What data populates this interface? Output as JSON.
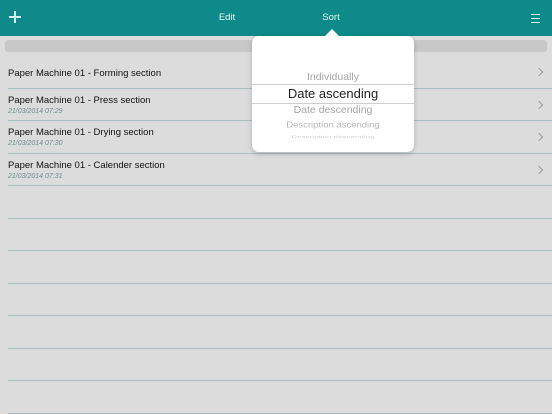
{
  "toolbar": {
    "edit_label": "Edit",
    "sort_label": "Sort",
    "add_icon": "plus-icon",
    "menu_icon": "hamburger-menu-icon",
    "background_color": "#0e8a8a"
  },
  "list": {
    "items": [
      {
        "title": "Paper Machine 01 - Forming section",
        "date": ""
      },
      {
        "title": "Paper Machine 01 - Press section",
        "date": "21/03/2014 07:29"
      },
      {
        "title": "Paper Machine 01 - Drying section",
        "date": "21/03/2014 07:30"
      },
      {
        "title": "Paper Machine 01 - Calender section",
        "date": "21/03/2014 07:31"
      }
    ]
  },
  "sort_popover": {
    "selected": "Date ascending",
    "options": [
      "Individually",
      "Date ascending",
      "Date descending",
      "Description ascending",
      "Description descending"
    ]
  }
}
